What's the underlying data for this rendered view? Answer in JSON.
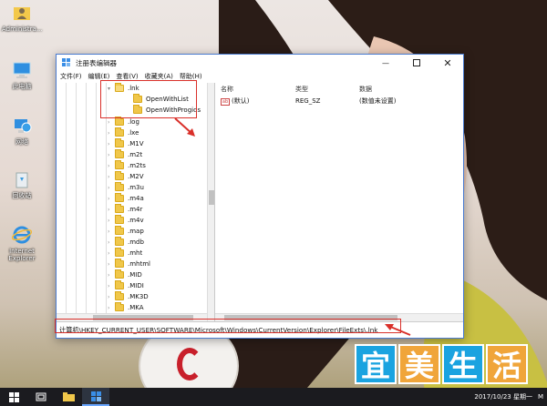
{
  "desktop_icons": [
    {
      "name": "user-folder-icon",
      "label": "Administra..."
    },
    {
      "name": "this-pc-icon",
      "label": "此电脑"
    },
    {
      "name": "network-icon",
      "label": "网络"
    },
    {
      "name": "recycle-bin-icon",
      "label": "回收站"
    },
    {
      "name": "internet-explorer-icon",
      "label": "Internet Explorer"
    }
  ],
  "window": {
    "title": "注册表编辑器",
    "menu": [
      "文件(F)",
      "编辑(E)",
      "查看(V)",
      "收藏夹(A)",
      "帮助(H)"
    ]
  },
  "tree": {
    "items": [
      {
        "label": ".lnk",
        "open": true,
        "chevron": "v"
      },
      {
        "label": "OpenWithList",
        "open": false,
        "chevron": ""
      },
      {
        "label": "OpenWithProgids",
        "open": false,
        "chevron": ""
      },
      {
        "label": ".log",
        "open": false,
        "chevron": ">"
      },
      {
        "label": ".lxe",
        "open": false,
        "chevron": ">"
      },
      {
        "label": ".M1V",
        "open": false,
        "chevron": ">"
      },
      {
        "label": ".m2t",
        "open": false,
        "chevron": ">"
      },
      {
        "label": ".m2ts",
        "open": false,
        "chevron": ">"
      },
      {
        "label": ".M2V",
        "open": false,
        "chevron": ">"
      },
      {
        "label": ".m3u",
        "open": false,
        "chevron": ">"
      },
      {
        "label": ".m4a",
        "open": false,
        "chevron": ">"
      },
      {
        "label": ".m4r",
        "open": false,
        "chevron": ">"
      },
      {
        "label": ".m4v",
        "open": false,
        "chevron": ">"
      },
      {
        "label": ".map",
        "open": false,
        "chevron": ">"
      },
      {
        "label": ".mdb",
        "open": false,
        "chevron": ">"
      },
      {
        "label": ".mht",
        "open": false,
        "chevron": ">"
      },
      {
        "label": ".mhtml",
        "open": false,
        "chevron": ">"
      },
      {
        "label": ".MID",
        "open": false,
        "chevron": ">"
      },
      {
        "label": ".MIDI",
        "open": false,
        "chevron": ">"
      },
      {
        "label": ".MK3D",
        "open": false,
        "chevron": ">"
      },
      {
        "label": ".MKA",
        "open": false,
        "chevron": ">"
      }
    ]
  },
  "list": {
    "headers": {
      "name": "名称",
      "type": "类型",
      "data": "数据"
    },
    "rows": [
      {
        "name": "(默认)",
        "type": "REG_SZ",
        "data": "(数值未设置)"
      }
    ]
  },
  "statusbar": {
    "path": "计算机\\HKEY_CURRENT_USER\\SOFTWARE\\Microsoft\\Windows\\CurrentVersion\\Explorer\\FileExts\\.lnk"
  },
  "watermark": {
    "chars": [
      "宜",
      "美",
      "生",
      "活"
    ]
  },
  "taskbar": {
    "clock": "2017/10/23 星期一",
    "ime": "M"
  },
  "colors": {
    "annotation": "#d9302a",
    "accent": "#4a7bd0"
  }
}
